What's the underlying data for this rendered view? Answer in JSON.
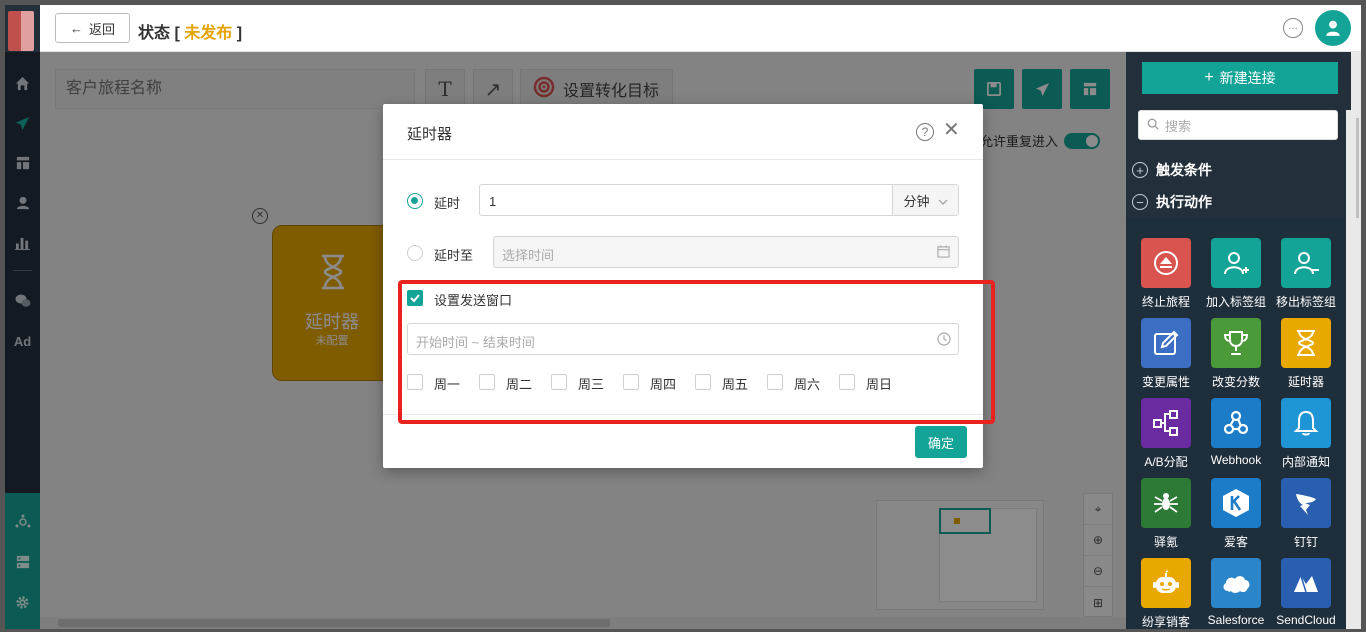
{
  "header": {
    "back_label": "返回",
    "status_prefix": "状态",
    "status_open": "[",
    "status_value": "未发布",
    "status_close": "]"
  },
  "toolbar": {
    "journey_name_placeholder": "客户旅程名称",
    "text_tool_label": "T",
    "arrow_tool_label": "↗",
    "goal_label": "设置转化目标",
    "allow_reenter_label": "允许重复进入",
    "allow_reenter_on": true
  },
  "node": {
    "title": "延时器",
    "subtitle": "未配置"
  },
  "modal": {
    "title": "延时器",
    "help": "?",
    "close": "✕",
    "delay_label": "延时",
    "delay_value": "1",
    "delay_unit": "分钟",
    "delay_until_label": "延时至",
    "delay_until_placeholder": "选择时间",
    "send_window_label": "设置发送窗口",
    "send_window_checked": true,
    "range_placeholder": "开始时间 ~ 结束时间",
    "weekdays": [
      "周一",
      "周二",
      "周三",
      "周四",
      "周五",
      "周六",
      "周日"
    ],
    "confirm_label": "确定"
  },
  "panel": {
    "new_connection_label": "新建连接",
    "search_placeholder": "搜索",
    "sections": [
      "触发条件",
      "执行动作"
    ],
    "tiles": [
      {
        "label": "终止旅程",
        "color": "#d9534f",
        "icon": "stop-icon"
      },
      {
        "label": "加入标签组",
        "color": "#14a497",
        "icon": "add-user-icon"
      },
      {
        "label": "移出标签组",
        "color": "#14a497",
        "icon": "remove-user-icon"
      },
      {
        "label": "变更属性",
        "color": "#3c6fc4",
        "icon": "edit-icon"
      },
      {
        "label": "改变分数",
        "color": "#4a9a3a",
        "icon": "trophy-icon"
      },
      {
        "label": "延时器",
        "color": "#e8a800",
        "icon": "hourglass-icon"
      },
      {
        "label": "A/B分配",
        "color": "#6a2ba0",
        "icon": "ab-split-icon"
      },
      {
        "label": "Webhook",
        "color": "#1d7cc7",
        "icon": "webhook-icon"
      },
      {
        "label": "内部通知",
        "color": "#1f95d6",
        "icon": "bell-icon"
      },
      {
        "label": "驿氪",
        "color": "#2c7a35",
        "icon": "spider-icon"
      },
      {
        "label": "爱客",
        "color": "#1d7cc7",
        "icon": "k-logo-icon"
      },
      {
        "label": "钉钉",
        "color": "#2a5fb0",
        "icon": "dingtalk-icon"
      },
      {
        "label": "纷享销客",
        "color": "#e8a800",
        "icon": "robot-icon"
      },
      {
        "label": "Salesforce",
        "color": "#2a85c9",
        "icon": "cloud-icon"
      },
      {
        "label": "SendCloud",
        "color": "#2a5fb0",
        "icon": "sendcloud-icon"
      }
    ]
  },
  "nav": {
    "ad_label": "Ad"
  }
}
